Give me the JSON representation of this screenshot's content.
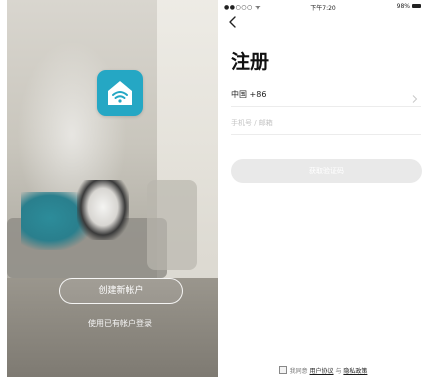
{
  "left_screen": {
    "create_account_label": "创建新帐户",
    "login_existing_label": "使用已有帐户登录",
    "app_icon": "home-wifi-icon",
    "accent_color": "#25a7c4"
  },
  "right_screen": {
    "status_bar": {
      "signal": "●●○○○ ᯤ",
      "time": "下午7:20",
      "battery": "98%"
    },
    "back_icon": "chevron-left-icon",
    "title": "注册",
    "country": {
      "label": "中国 +86",
      "chevron_icon": "chevron-right-icon"
    },
    "phone_field": {
      "placeholder": "手机号 / 邮箱",
      "value": ""
    },
    "get_code_label": "获取验证码",
    "agreement": {
      "prefix": "我同意",
      "user_agreement": "用户协议",
      "conjunction": "与",
      "privacy_policy": "隐私政策"
    }
  }
}
